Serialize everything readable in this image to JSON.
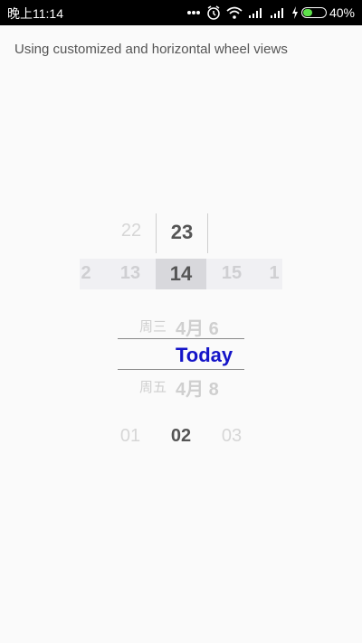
{
  "status_bar": {
    "time": "晚上11:14",
    "battery": "40%",
    "icons": [
      "more-icon",
      "alarm-icon",
      "wifi-icon",
      "signal-icon",
      "signal-icon",
      "charging-icon",
      "battery-icon"
    ]
  },
  "subtitle": "Using customized and horizontal wheel views",
  "vertical_wheel": {
    "prev": "22",
    "selected": "23"
  },
  "horizontal_wheel": {
    "items": [
      "2",
      "13",
      "14",
      "15",
      "1"
    ],
    "selected_index": 2
  },
  "date_picker": {
    "prev": {
      "weekday": "周三",
      "date": "4月 6"
    },
    "selected": "Today",
    "next": {
      "weekday": "周五",
      "date": "4月 8"
    },
    "selected_color": "#1414c8"
  },
  "bottom_wheel": {
    "items": [
      "01",
      "02",
      "03"
    ],
    "selected_index": 1
  }
}
